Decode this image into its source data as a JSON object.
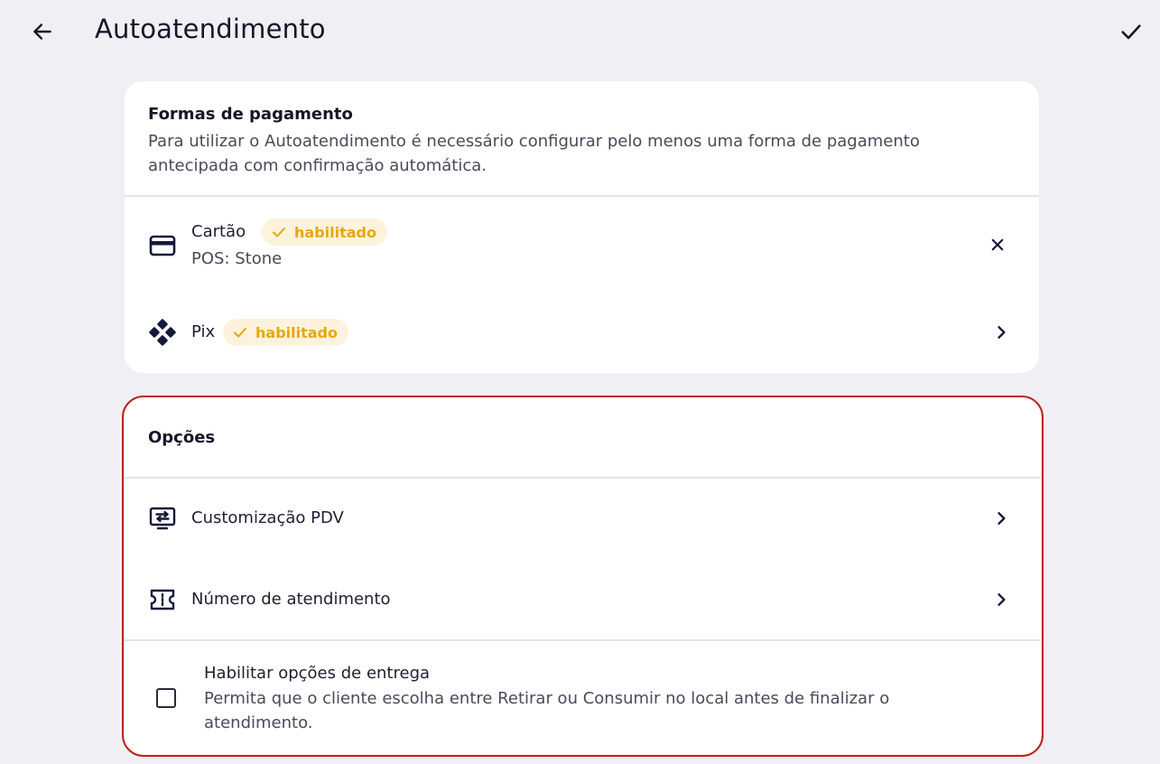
{
  "header": {
    "title": "Autoatendimento",
    "back_icon": "arrow-left-icon",
    "confirm_icon": "check-icon"
  },
  "payments": {
    "title": "Formas de pagamento",
    "description": "Para utilizar o Autoatendimento é necessário configurar pelo menos uma forma de pagamento antecipada com confirmação automática.",
    "methods": [
      {
        "icon": "credit-card-icon",
        "label": "Cartão",
        "badge": "habilitado",
        "subtitle": "POS: Stone",
        "action_icon": "close-icon"
      },
      {
        "icon": "pix-icon",
        "label": "Pix",
        "badge": "habilitado",
        "action_icon": "chevron-right-icon"
      }
    ]
  },
  "options": {
    "title": "Opções",
    "items": [
      {
        "icon": "monitor-transfer-icon",
        "label": "Customização PDV",
        "action_icon": "chevron-right-icon"
      },
      {
        "icon": "ticket-icon",
        "label": "Número de atendimento",
        "action_icon": "chevron-right-icon"
      }
    ],
    "delivery": {
      "label": "Habilitar opções de entrega",
      "description": "Permita que o cliente escolha entre Retirar ou Consumir no local antes de finalizar o atendimento.",
      "checked": false
    }
  },
  "colors": {
    "background": "#f0f0f4",
    "card": "#ffffff",
    "badge_bg": "#fdf3dc",
    "badge_text": "#e8a800",
    "highlight_border": "#c0211a",
    "icon_navy": "#14183a"
  }
}
